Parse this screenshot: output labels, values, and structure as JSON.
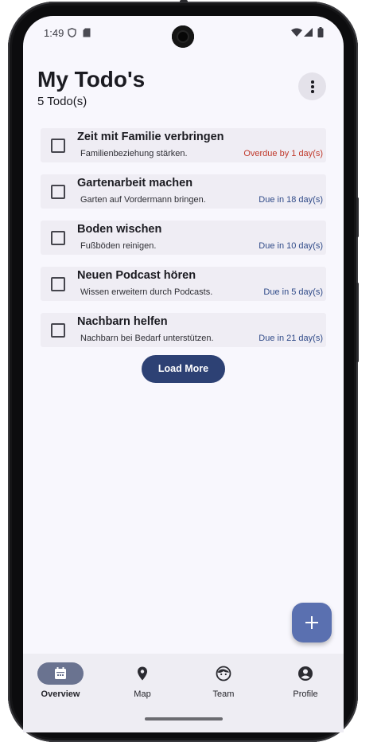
{
  "status_bar": {
    "time": "1:49",
    "icons": [
      "shield-icon",
      "sd-card-icon",
      "wifi-icon",
      "signal-icon",
      "battery-icon"
    ]
  },
  "header": {
    "title": "My Todo's",
    "count": "5 Todo(s)",
    "menu_icon": "more-vert-icon"
  },
  "todos": [
    {
      "title": "Zeit mit Familie verbringen",
      "description": "Familienbeziehung stärken.",
      "due": "Overdue by 1 day(s)",
      "overdue": true,
      "checked": false
    },
    {
      "title": "Gartenarbeit machen",
      "description": "Garten auf Vordermann bringen.",
      "due": "Due in 18 day(s)",
      "overdue": false,
      "checked": false
    },
    {
      "title": "Boden wischen",
      "description": "Fußböden reinigen.",
      "due": "Due in 10 day(s)",
      "overdue": false,
      "checked": false
    },
    {
      "title": "Neuen Podcast hören",
      "description": "Wissen erweitern durch Podcasts.",
      "due": "Due in 5 day(s)",
      "overdue": false,
      "checked": false
    },
    {
      "title": "Nachbarn helfen",
      "description": "Nachbarn bei Bedarf unterstützen.",
      "due": "Due in 21 day(s)",
      "overdue": false,
      "checked": false
    }
  ],
  "load_more_label": "Load More",
  "fab": {
    "icon": "add-icon"
  },
  "nav": {
    "items": [
      {
        "label": "Overview",
        "icon": "calendar-icon",
        "active": true
      },
      {
        "label": "Map",
        "icon": "location-pin-icon",
        "active": false
      },
      {
        "label": "Team",
        "icon": "face-icon",
        "active": false
      },
      {
        "label": "Profile",
        "icon": "account-circle-icon",
        "active": false
      }
    ]
  },
  "colors": {
    "background": "#f8f7fd",
    "card": "#efedf4",
    "primary": "#2d4174",
    "fab": "#5a70b0",
    "due_text": "#2f4a88",
    "overdue_text": "#c0392b",
    "nav_bar": "#eeedf3",
    "nav_active_pill": "#6a7390"
  }
}
